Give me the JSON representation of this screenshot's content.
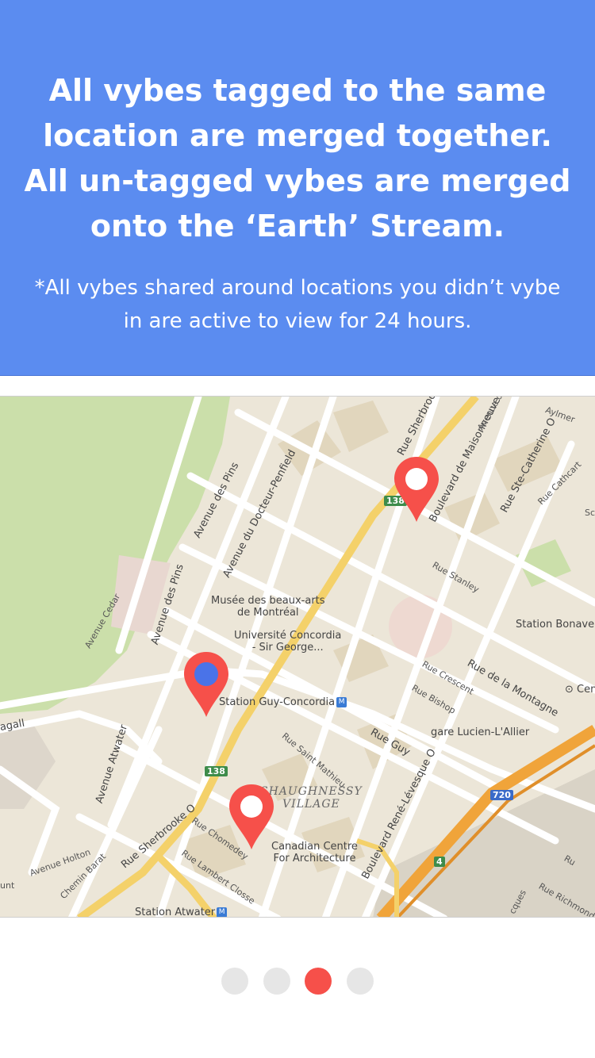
{
  "header": {
    "headline": "All vybes tagged to the same location are merged together. All un-tagged vybes are merged onto the ‘Earth’ Stream.",
    "note": "*All vybes shared around locations you didn’t vybe in are active to view for 24 hours."
  },
  "map": {
    "labels": {
      "sherbrooke_top": "Rue Sherbrooke O",
      "maisonneuve": "Boulevard de Maisonneuve O",
      "ste_catherine": "Rue Ste-Catherine O",
      "cathcart": "Rue Cathcart",
      "avenue_top": "Avenue d",
      "aylmer": "Aylmer",
      "docteur_penfield": "Avenue du Docteur-Penfield",
      "des_pins_1": "Avenue des Pins",
      "des_pins_2": "Avenue des Pins",
      "cedar": "Avenue Cedar",
      "musee": "Musée des beaux-arts\nde Montréal",
      "concordia": "Université Concordia\n- Sir George...",
      "stanley": "Rue Stanley",
      "station_bonaventure": "Station Bonaver",
      "crescent": "Rue Crescent",
      "bishop": "Rue Bishop",
      "montagne": "Rue de la Montagne",
      "ce": "Cen",
      "station_guy": "Station Guy-Concordia",
      "guy": "Rue Guy",
      "saint_mathieu": "Rue Saint Mathieu",
      "lucien": "gare Lucien-L'Allier",
      "shaughnessy": "SHAUGHNESSY\nVILLAGE",
      "levesque": "Boulevard René-Lévesque O",
      "atwater": "Avenue Atwater",
      "sherbrooke_bottom": "Rue Sherbrooke O",
      "chomedey": "Rue Chomedey",
      "lambert": "Rue Lambert Closse",
      "cca": "Canadian Centre\nFor Architecture",
      "holton": "Avenue Holton",
      "barat": "Chemin Barat",
      "station_atwater": "Station Atwater",
      "ru": "Ru",
      "richmond": "Rue Richmond",
      "cques": "cques",
      "gall": "agall",
      "unt": "unt",
      "sc": "Sc"
    },
    "shields": {
      "r138_top": "138",
      "r138_bottom": "138",
      "a720": "720",
      "a4": "4"
    },
    "metro_symbol": "M"
  },
  "pager": {
    "count": 4,
    "active_index": 2
  },
  "colors": {
    "header_bg": "#5b8cf0",
    "pin": "#f6504a",
    "dot_active": "#f6504a",
    "dot_inactive": "#e6e6e6"
  }
}
